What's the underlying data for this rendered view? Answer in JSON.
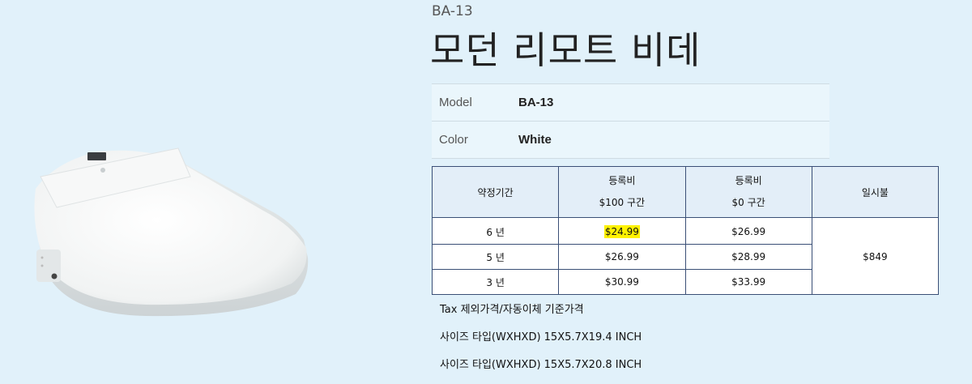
{
  "product": {
    "sku": "BA-13",
    "title": "모던 리모트 비데"
  },
  "specs": [
    {
      "key": "Model",
      "value": "BA-13"
    },
    {
      "key": "Color",
      "value": "White"
    }
  ],
  "price_table": {
    "headers": {
      "period": "약정기간",
      "plan_100_line1": "등록비",
      "plan_100_line2": "$100  구간",
      "plan_0_line1": "등록비",
      "plan_0_line2": "$0  구간",
      "lump_sum": "일시불"
    },
    "rows": [
      {
        "period": "6  년",
        "plan_100": "$24.99",
        "plan_0": "$26.99"
      },
      {
        "period": "5  년",
        "plan_100": "$26.99",
        "plan_0": "$28.99"
      },
      {
        "period": "3  년",
        "plan_100": "$30.99",
        "plan_0": "$33.99"
      }
    ],
    "lump_sum_price": "$849",
    "highlight_color": "#fff200"
  },
  "notes": [
    "Tax 제외가격/자동이체 기준가격",
    "사이즈 타입(WXHXD) 15X5.7X19.4 INCH",
    "사이즈 타입(WXHXD) 15X5.7X20.8 INCH"
  ]
}
